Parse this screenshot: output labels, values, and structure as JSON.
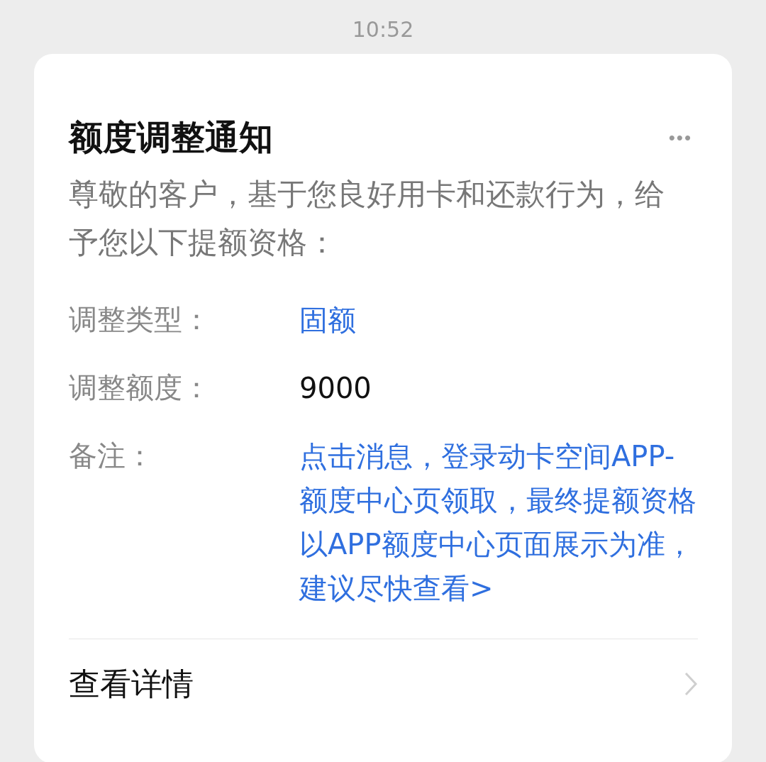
{
  "status_time": "10:52",
  "card": {
    "title": "额度调整通知",
    "menu_glyph": "•••",
    "message": "尊敬的客户，基于您良好用卡和还款行为，给予您以下提额资格：",
    "fields": [
      {
        "label": "调整类型：",
        "value": "固额",
        "kind": "link"
      },
      {
        "label": "调整额度：",
        "value": "9000",
        "kind": "plain"
      },
      {
        "label": "备注：",
        "value": "点击消息，登录动卡空间APP-额度中心页领取，最终提额资格以APP额度中心页面展示为准，建议尽快查看>",
        "kind": "link"
      }
    ],
    "footer_link": "查看详情"
  }
}
